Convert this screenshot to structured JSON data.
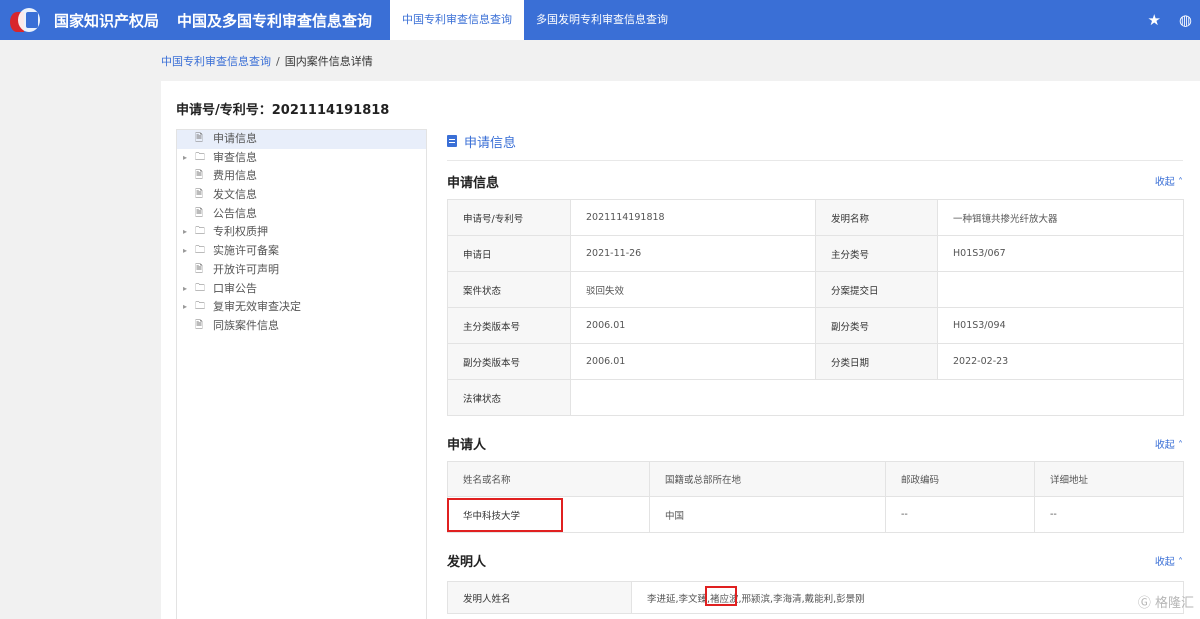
{
  "topbar": {
    "org_name": "国家知识产权局",
    "app_title": "中国及多国专利审查信息查询",
    "tabs": [
      "中国专利审查信息查询",
      "多国发明专利审查信息查询"
    ],
    "star_icon": "★",
    "globe_icon": "◍"
  },
  "breadcrumb": {
    "link": "中国专利审查信息查询",
    "sep": "/",
    "current": "国内案件信息详情"
  },
  "app_number": "申请号/专利号：2021114191818",
  "tree": {
    "items": [
      {
        "label": "申请信息",
        "type": "file",
        "expandable": false
      },
      {
        "label": "审查信息",
        "type": "folder",
        "expandable": true
      },
      {
        "label": "费用信息",
        "type": "file",
        "expandable": false
      },
      {
        "label": "发文信息",
        "type": "file",
        "expandable": false
      },
      {
        "label": "公告信息",
        "type": "file",
        "expandable": false
      },
      {
        "label": "专利权质押",
        "type": "folder",
        "expandable": true
      },
      {
        "label": "实施许可备案",
        "type": "folder",
        "expandable": true
      },
      {
        "label": "开放许可声明",
        "type": "file",
        "expandable": false
      },
      {
        "label": "口审公告",
        "type": "folder",
        "expandable": true
      },
      {
        "label": "复审无效审查决定",
        "type": "folder",
        "expandable": true
      },
      {
        "label": "同族案件信息",
        "type": "file",
        "expandable": false
      }
    ]
  },
  "section_header": "申请信息",
  "app_info": {
    "title": "申请信息",
    "collapse": "收起 ˄",
    "rows": [
      {
        "l1": "申请号/专利号",
        "v1": "2021114191818",
        "l2": "发明名称",
        "v2": "一种铒镱共掺光纤放大器"
      },
      {
        "l1": "申请日",
        "v1": "2021-11-26",
        "l2": "主分类号",
        "v2": "H01S3/067"
      },
      {
        "l1": "案件状态",
        "v1": "驳回失效",
        "l2": "分案提交日",
        "v2": ""
      },
      {
        "l1": "主分类版本号",
        "v1": "2006.01",
        "l2": "副分类号",
        "v2": "H01S3/094"
      },
      {
        "l1": "副分类版本号",
        "v1": "2006.01",
        "l2": "分类日期",
        "v2": "2022-02-23"
      }
    ],
    "legal_label": "法律状态",
    "legal_value": ""
  },
  "applicant": {
    "title": "申请人",
    "collapse": "收起 ˄",
    "headers": [
      "姓名或名称",
      "国籍或总部所在地",
      "邮政编码",
      "详细地址"
    ],
    "rows": [
      {
        "name": "华中科技大学",
        "country": "中国",
        "postcode": "--",
        "address": "--"
      }
    ]
  },
  "inventor": {
    "title": "发明人",
    "collapse": "收起 ˄",
    "label": "发明人姓名",
    "value": "李进延,李文臻,褚应波,邢颍滨,李海清,戴能利,彭景刚"
  },
  "watermark": "Ⓖ 格隆汇"
}
